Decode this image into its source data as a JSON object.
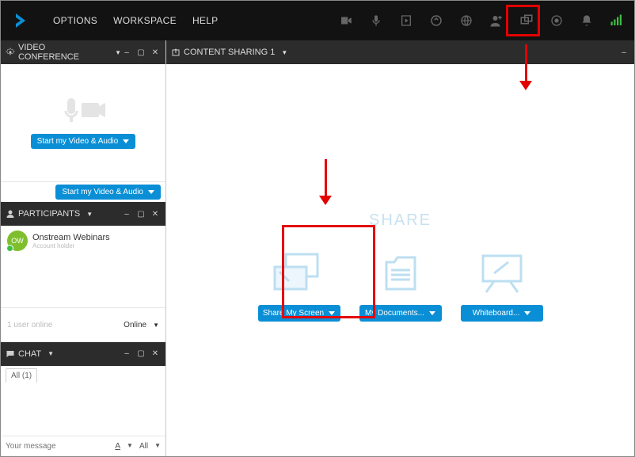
{
  "topbar": {
    "menu": {
      "options": "OPTIONS",
      "workspace": "WORKSPACE",
      "help": "HELP"
    }
  },
  "videoconf": {
    "title": "VIDEO CONFERENCE",
    "start_btn": "Start my Video & Audio",
    "footer_btn": "Start my Video & Audio"
  },
  "participants": {
    "title": "PARTICIPANTS",
    "user": {
      "initials": "OW",
      "name": "Onstream Webinars",
      "role": "Account holder"
    },
    "footer_left": "1 user online",
    "footer_right": "Online"
  },
  "chat": {
    "title": "CHAT",
    "tab_all": "All (1)",
    "placeholder": "Your message",
    "format": "A",
    "to": "All"
  },
  "content": {
    "title": "CONTENT SHARING 1",
    "share_heading": "SHARE",
    "share_screen": "Share My Screen",
    "my_docs": "My Documents...",
    "whiteboard": "Whiteboard..."
  }
}
